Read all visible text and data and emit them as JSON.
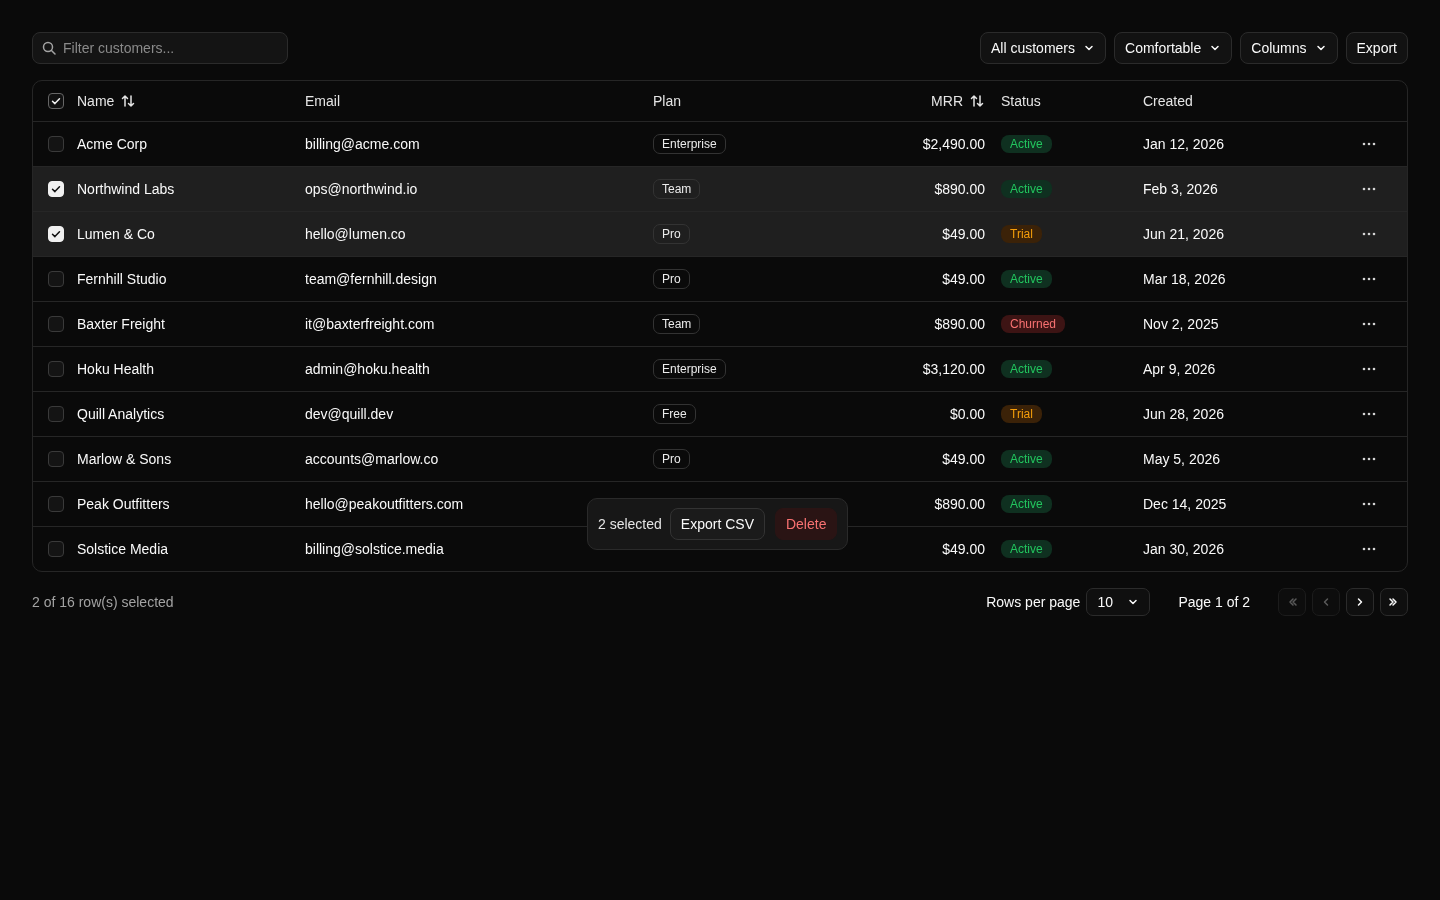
{
  "toolbar": {
    "filter": {
      "placeholder": "Filter customers..."
    },
    "buttons": [
      {
        "label": "All customers",
        "kind": "dropdown"
      },
      {
        "label": "Comfortable",
        "kind": "dropdown"
      },
      {
        "label": "Columns",
        "kind": "dropdown"
      },
      {
        "label": "Export",
        "kind": "plain"
      }
    ]
  },
  "table": {
    "select_all": {
      "checked": true
    },
    "columns": [
      {
        "label": "Name",
        "sortable": true
      },
      {
        "label": "Email",
        "sortable": false
      },
      {
        "label": "Plan",
        "sortable": false
      },
      {
        "label": "MRR",
        "sortable": true
      },
      {
        "label": "Status",
        "sortable": false
      },
      {
        "label": "Created",
        "sortable": false
      }
    ],
    "rows": [
      {
        "selected": false,
        "name": "Acme Corp",
        "email": "billing@acme.com",
        "plan": "Enterprise",
        "mrr": "$2,490.00",
        "status": {
          "label": "Active",
          "kind": "active"
        },
        "created": "Jan 12, 2026"
      },
      {
        "selected": true,
        "name": "Northwind Labs",
        "email": "ops@northwind.io",
        "plan": "Team",
        "mrr": "$890.00",
        "status": {
          "label": "Active",
          "kind": "active"
        },
        "created": "Feb 3, 2026"
      },
      {
        "selected": true,
        "name": "Lumen & Co",
        "email": "hello@lumen.co",
        "plan": "Pro",
        "mrr": "$49.00",
        "status": {
          "label": "Trial",
          "kind": "trial"
        },
        "created": "Jun 21, 2026"
      },
      {
        "selected": false,
        "name": "Fernhill Studio",
        "email": "team@fernhill.design",
        "plan": "Pro",
        "mrr": "$49.00",
        "status": {
          "label": "Active",
          "kind": "active"
        },
        "created": "Mar 18, 2026"
      },
      {
        "selected": false,
        "name": "Baxter Freight",
        "email": "it@baxterfreight.com",
        "plan": "Team",
        "mrr": "$890.00",
        "status": {
          "label": "Churned",
          "kind": "churned"
        },
        "created": "Nov 2, 2025"
      },
      {
        "selected": false,
        "name": "Hoku Health",
        "email": "admin@hoku.health",
        "plan": "Enterprise",
        "mrr": "$3,120.00",
        "status": {
          "label": "Active",
          "kind": "active"
        },
        "created": "Apr 9, 2026"
      },
      {
        "selected": false,
        "name": "Quill Analytics",
        "email": "dev@quill.dev",
        "plan": "Free",
        "mrr": "$0.00",
        "status": {
          "label": "Trial",
          "kind": "trial"
        },
        "created": "Jun 28, 2026"
      },
      {
        "selected": false,
        "name": "Marlow & Sons",
        "email": "accounts@marlow.co",
        "plan": "Pro",
        "mrr": "$49.00",
        "status": {
          "label": "Active",
          "kind": "active"
        },
        "created": "May 5, 2026"
      },
      {
        "selected": false,
        "name": "Peak Outfitters",
        "email": "hello@peakoutfitters.com",
        "mrr": "$890.00",
        "status": {
          "label": "Active",
          "kind": "active"
        },
        "created": "Dec 14, 2025"
      },
      {
        "selected": false,
        "name": "Solstice Media",
        "email": "billing@solstice.media",
        "mrr": "$49.00",
        "status": {
          "label": "Active",
          "kind": "active"
        },
        "created": "Jan 30, 2026"
      }
    ]
  },
  "bulk_bar": {
    "count": "2 selected",
    "actions": [
      {
        "label": "Export CSV",
        "kind": "normal"
      },
      {
        "label": "Delete",
        "kind": "danger"
      }
    ]
  },
  "footer": {
    "selection": "2 of 16 row(s) selected",
    "rows_per_page_label": "Rows per page",
    "rows_per_page": "10",
    "page": "Page 1 of 2",
    "pager": [
      {
        "kind": "first",
        "disabled": true
      },
      {
        "kind": "prev",
        "disabled": true
      },
      {
        "kind": "next",
        "disabled": false
      },
      {
        "kind": "last",
        "disabled": false
      }
    ]
  }
}
